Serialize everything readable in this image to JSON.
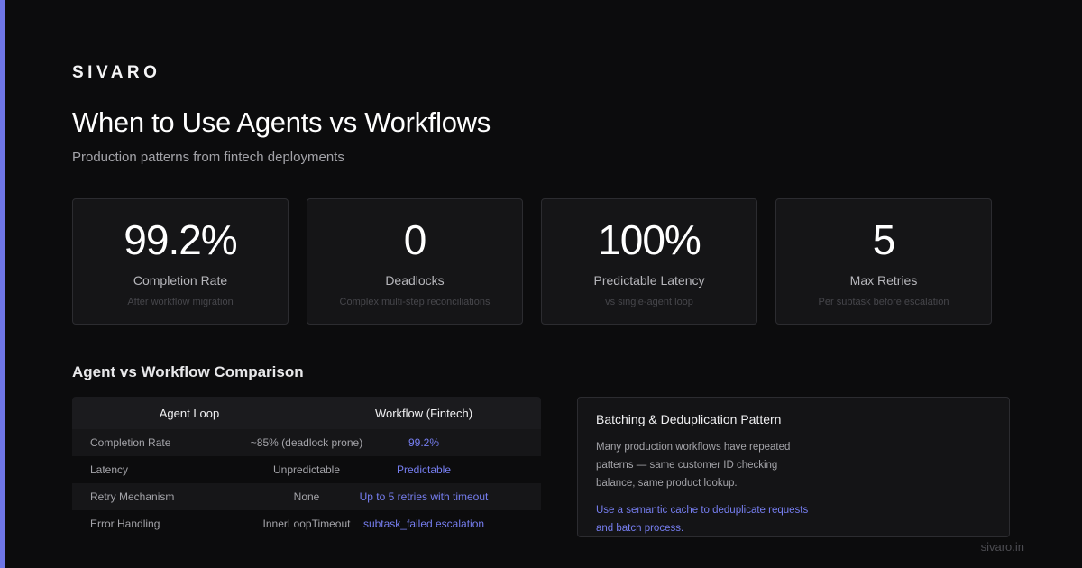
{
  "brand": "SIVARO",
  "title": "When to Use Agents vs Workflows",
  "subtitle": "Production patterns from fintech deployments",
  "stats": [
    {
      "value": "99.2%",
      "label": "Completion Rate",
      "sub": "After workflow migration"
    },
    {
      "value": "0",
      "label": "Deadlocks",
      "sub": "Complex multi-step reconciliations"
    },
    {
      "value": "100%",
      "label": "Predictable Latency",
      "sub": "vs single-agent loop"
    },
    {
      "value": "5",
      "label": "Max Retries",
      "sub": "Per subtask before escalation"
    }
  ],
  "comparison": {
    "title": "Agent vs Workflow Comparison",
    "headers": {
      "agent": "Agent Loop",
      "workflow": "Workflow (Fintech)"
    },
    "rows": [
      {
        "metric": "Completion Rate",
        "agent": "~85% (deadlock prone)",
        "workflow": "99.2%"
      },
      {
        "metric": "Latency",
        "agent": "Unpredictable",
        "workflow": "Predictable"
      },
      {
        "metric": "Retry Mechanism",
        "agent": "None",
        "workflow": "Up to 5 retries with timeout"
      },
      {
        "metric": "Error Handling",
        "agent": "InnerLoopTimeout",
        "workflow": "subtask_failed escalation"
      }
    ]
  },
  "panel": {
    "title": "Batching & Deduplication Pattern",
    "body": "Many production workflows have repeated patterns — same customer ID checking balance, same product lookup.",
    "tip": "Use a semantic cache to deduplicate requests and batch process."
  },
  "footer": "sivaro.in",
  "colors": {
    "accent": "#6f76e6",
    "highlight": "#767ef0",
    "background": "#0c0c0d"
  }
}
